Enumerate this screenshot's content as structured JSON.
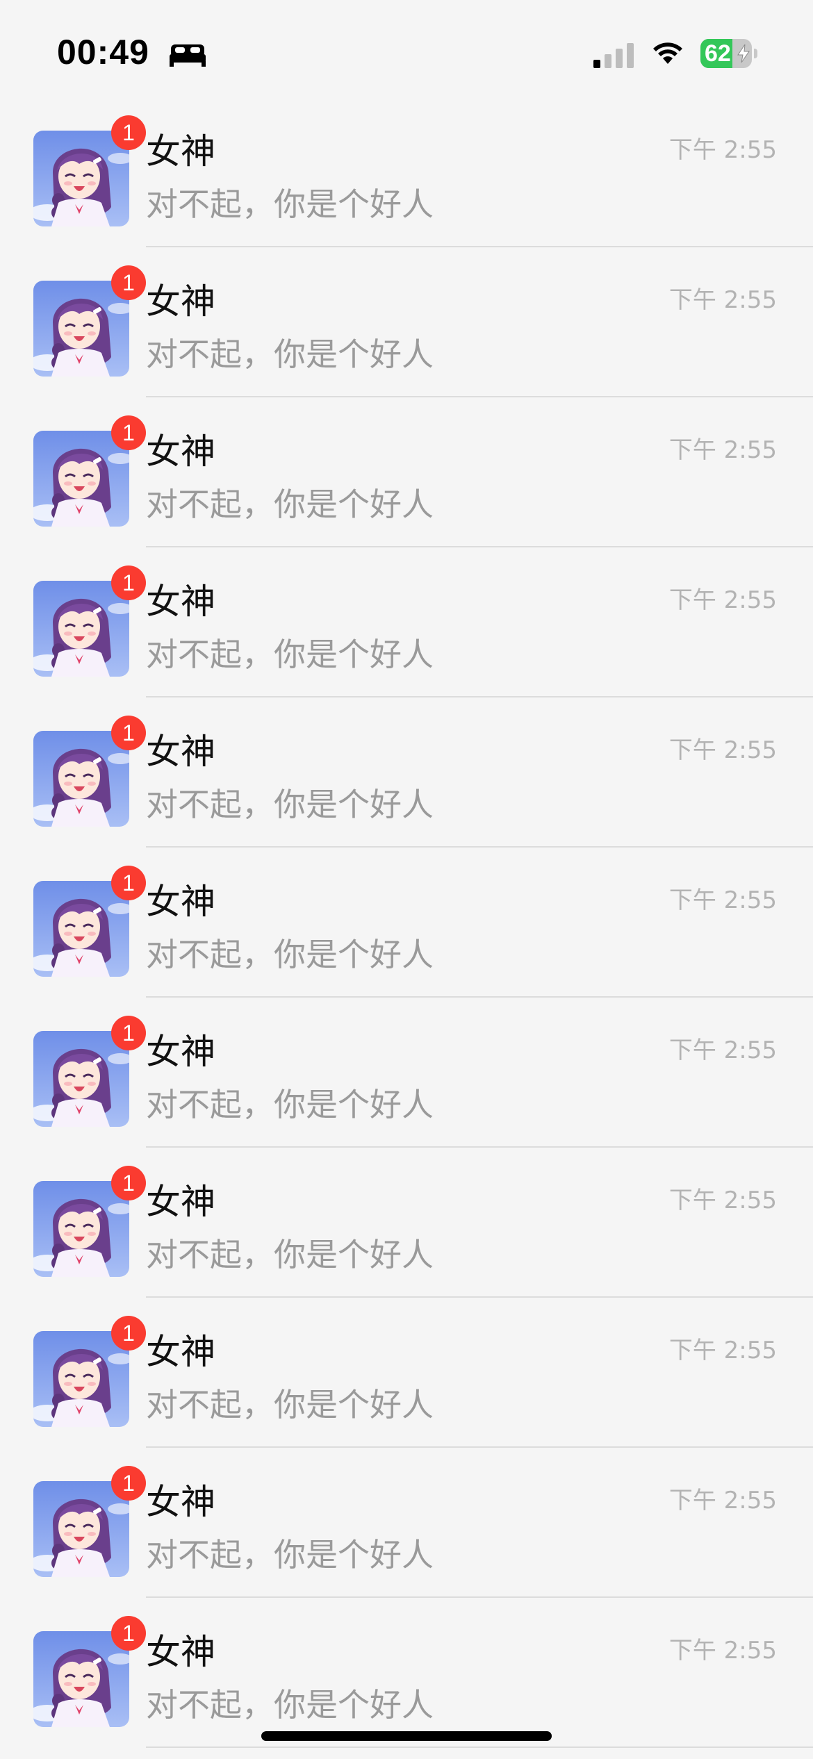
{
  "status_bar": {
    "time": "00:49",
    "focus_icon": "bed-icon",
    "signal_icon": "cellular-signal-icon",
    "wifi_icon": "wifi-icon",
    "battery_level": "62",
    "battery_charging": true,
    "battery_color": "#34c759"
  },
  "chats": [
    {
      "name": "女神",
      "time": "下午 2:55",
      "message": "对不起，你是个好人",
      "unread": "1"
    },
    {
      "name": "女神",
      "time": "下午 2:55",
      "message": "对不起，你是个好人",
      "unread": "1"
    },
    {
      "name": "女神",
      "time": "下午 2:55",
      "message": "对不起，你是个好人",
      "unread": "1"
    },
    {
      "name": "女神",
      "time": "下午 2:55",
      "message": "对不起，你是个好人",
      "unread": "1"
    },
    {
      "name": "女神",
      "time": "下午 2:55",
      "message": "对不起，你是个好人",
      "unread": "1"
    },
    {
      "name": "女神",
      "time": "下午 2:55",
      "message": "对不起，你是个好人",
      "unread": "1"
    },
    {
      "name": "女神",
      "time": "下午 2:55",
      "message": "对不起，你是个好人",
      "unread": "1"
    },
    {
      "name": "女神",
      "time": "下午 2:55",
      "message": "对不起，你是个好人",
      "unread": "1"
    },
    {
      "name": "女神",
      "time": "下午 2:55",
      "message": "对不起，你是个好人",
      "unread": "1"
    },
    {
      "name": "女神",
      "time": "下午 2:55",
      "message": "对不起，你是个好人",
      "unread": "1"
    },
    {
      "name": "女神",
      "time": "下午 2:55",
      "message": "对不起，你是个好人",
      "unread": "1"
    }
  ],
  "colors": {
    "badge": "#fa3b30",
    "background": "#f5f5f5",
    "message_text": "#9a9a9a",
    "time_text": "#b3b3b3"
  }
}
